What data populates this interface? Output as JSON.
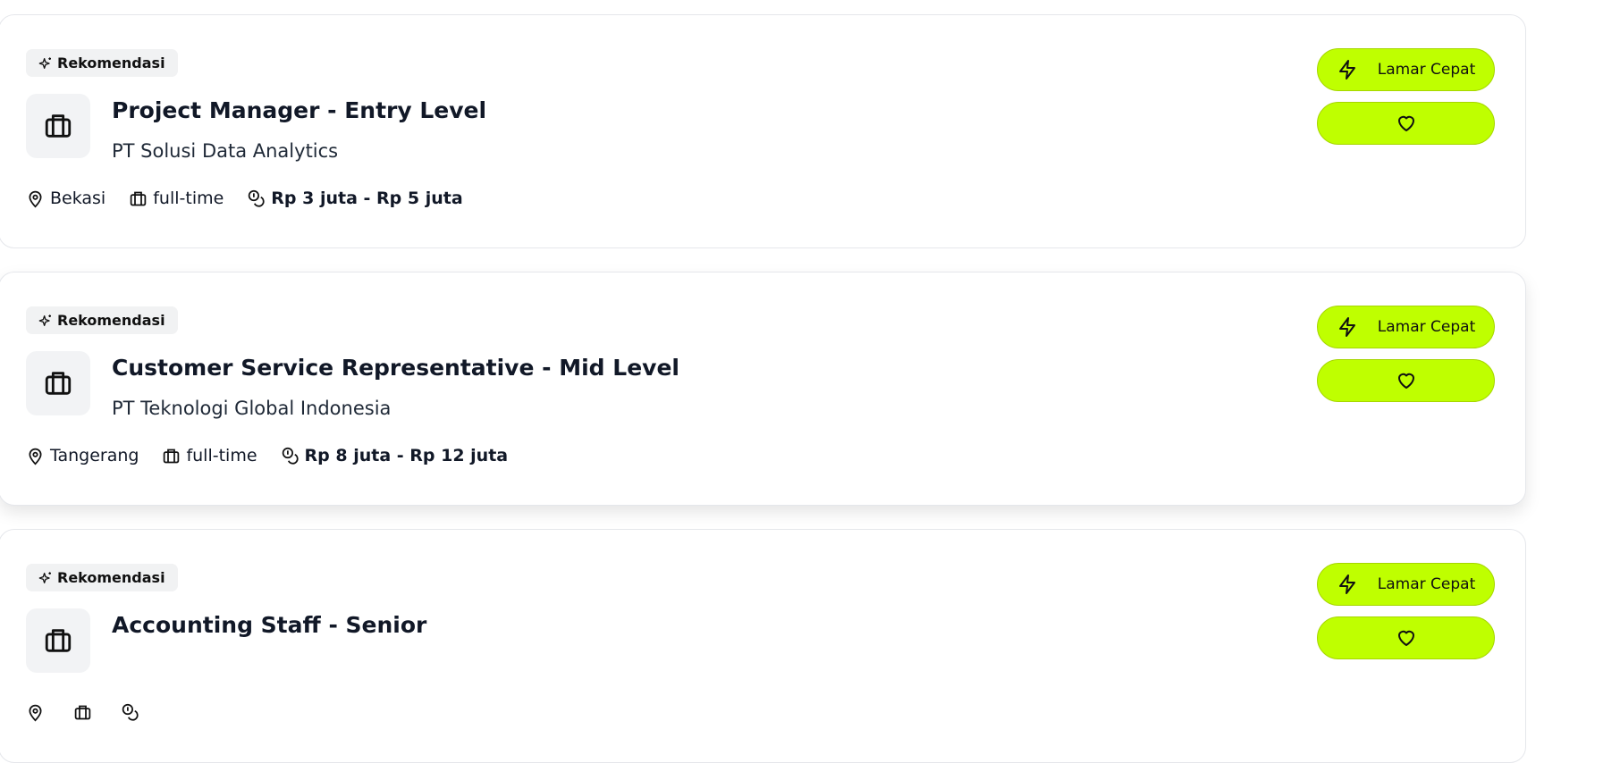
{
  "accent_color": "#bfff00",
  "jobs": [
    {
      "badge": "Rekomendasi",
      "title": "Project Manager - Entry Level",
      "company": "PT Solusi Data Analytics",
      "location": "Bekasi",
      "type": "full-time",
      "salary": "Rp 3 juta - Rp 5 juta",
      "apply_label": "Lamar Cepat"
    },
    {
      "badge": "Rekomendasi",
      "title": "Customer Service Representative - Mid Level",
      "company": "PT Teknologi Global Indonesia",
      "location": "Tangerang",
      "type": "full-time",
      "salary": "Rp 8 juta - Rp 12 juta",
      "apply_label": "Lamar Cepat"
    },
    {
      "badge": "Rekomendasi",
      "title": "Accounting Staff - Senior",
      "apply_label": "Lamar Cepat"
    }
  ]
}
